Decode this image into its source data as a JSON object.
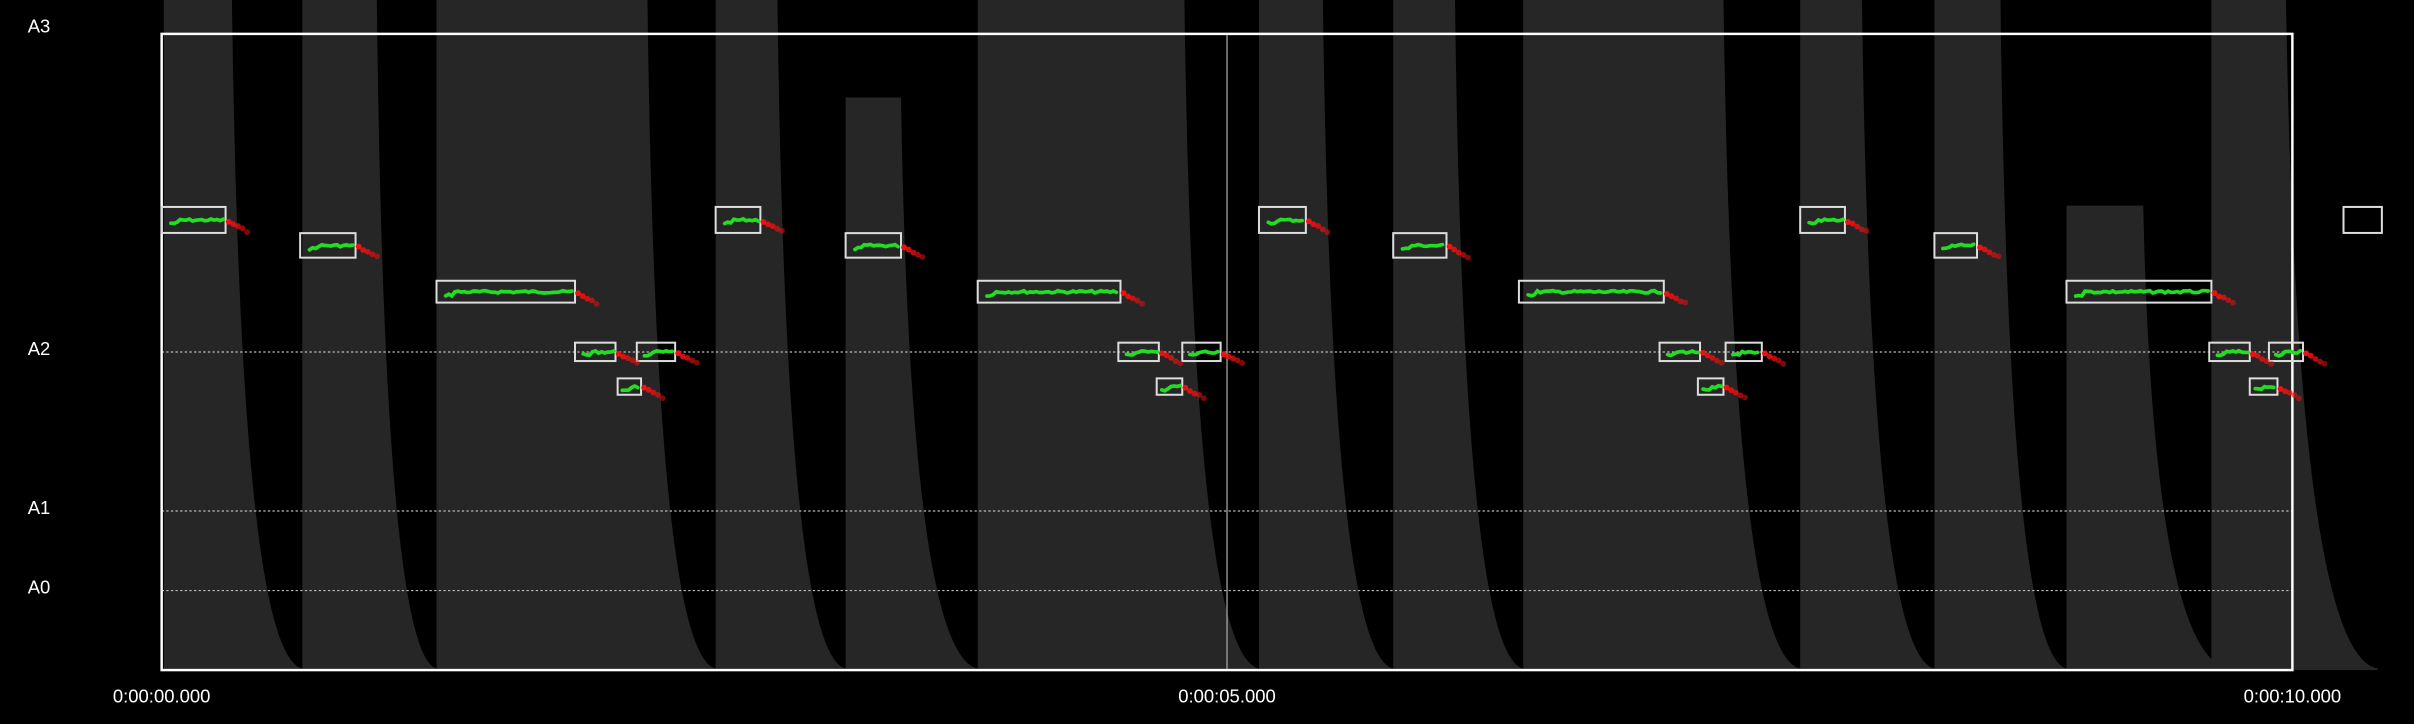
{
  "chart_data": {
    "type": "line",
    "title": "",
    "xlabel": "",
    "ylabel": "",
    "xlim": [
      0,
      10
    ],
    "ylim_hz": [
      0,
      220
    ],
    "x_ticks": [
      {
        "t": 0,
        "label": "0:00:00.000"
      },
      {
        "t": 5,
        "label": "0:00:05.000"
      },
      {
        "t": 10,
        "label": "0:00:10.000"
      }
    ],
    "y_ticks": [
      {
        "hz": 220,
        "label": "A3"
      },
      {
        "hz": 110,
        "label": "A2"
      },
      {
        "hz": 55,
        "label": "A1"
      },
      {
        "hz": 27.5,
        "label": "A0"
      }
    ],
    "grid": "dotted horizontal at A2, A1, A0; vertical at 0:00:05.000",
    "colors": {
      "background": "#000000",
      "envelope": "#262626",
      "frame": "#ffffff",
      "voiced": "#22dd22",
      "unvoiced": "#ee1111",
      "grid": "#bbbbbb"
    },
    "notes": [
      {
        "note": "D#3",
        "hz": 155.6,
        "start": 0.0,
        "end": 0.3
      },
      {
        "note": "D3",
        "hz": 146.8,
        "start": 0.65,
        "end": 0.91
      },
      {
        "note": "C3",
        "hz": 130.8,
        "start": 1.29,
        "end": 1.94
      },
      {
        "note": "A2",
        "hz": 110.0,
        "start": 1.94,
        "end": 2.13
      },
      {
        "note": "G2",
        "hz": 98.0,
        "start": 2.14,
        "end": 2.25
      },
      {
        "note": "A2",
        "hz": 110.0,
        "start": 2.23,
        "end": 2.41
      },
      {
        "note": "D#3",
        "hz": 155.6,
        "start": 2.6,
        "end": 2.81
      },
      {
        "note": "D3",
        "hz": 146.8,
        "start": 3.21,
        "end": 3.47
      },
      {
        "note": "C3",
        "hz": 130.8,
        "start": 3.83,
        "end": 4.5
      },
      {
        "note": "A2",
        "hz": 110.0,
        "start": 4.49,
        "end": 4.68
      },
      {
        "note": "G2",
        "hz": 98.0,
        "start": 4.67,
        "end": 4.79
      },
      {
        "note": "A2",
        "hz": 110.0,
        "start": 4.79,
        "end": 4.97
      },
      {
        "note": "D#3",
        "hz": 155.6,
        "start": 5.15,
        "end": 5.37
      },
      {
        "note": "D3",
        "hz": 146.8,
        "start": 5.78,
        "end": 6.03
      },
      {
        "note": "C3",
        "hz": 130.8,
        "start": 6.37,
        "end": 7.05
      },
      {
        "note": "A2",
        "hz": 110.0,
        "start": 7.03,
        "end": 7.22
      },
      {
        "note": "G2",
        "hz": 98.0,
        "start": 7.21,
        "end": 7.33
      },
      {
        "note": "A2",
        "hz": 110.0,
        "start": 7.34,
        "end": 7.51
      },
      {
        "note": "D#3",
        "hz": 155.6,
        "start": 7.69,
        "end": 7.9
      },
      {
        "note": "D3",
        "hz": 146.8,
        "start": 8.32,
        "end": 8.52
      },
      {
        "note": "C3",
        "hz": 130.8,
        "start": 8.94,
        "end": 9.62
      },
      {
        "note": "A2",
        "hz": 110.0,
        "start": 9.61,
        "end": 9.8
      },
      {
        "note": "G2",
        "hz": 98.0,
        "start": 9.8,
        "end": 9.93
      },
      {
        "note": "A2",
        "hz": 110.0,
        "start": 9.89,
        "end": 10.05
      },
      {
        "note": "D#3",
        "hz": 155.6,
        "start": 10.24,
        "end": 10.42
      }
    ],
    "envelope": [
      {
        "start": 0.01,
        "peak": 1.2,
        "decay": 0.33,
        "end": 0.66
      },
      {
        "start": 0.66,
        "peak": 1.2,
        "decay": 1.01,
        "end": 1.29
      },
      {
        "start": 1.29,
        "peak": 1.2,
        "decay": 2.28,
        "end": 2.6
      },
      {
        "start": 2.6,
        "peak": 1.2,
        "decay": 2.89,
        "end": 3.21
      },
      {
        "start": 3.21,
        "peak": 0.9,
        "decay": 3.47,
        "end": 3.83
      },
      {
        "start": 3.83,
        "peak": 1.2,
        "decay": 4.8,
        "end": 5.15
      },
      {
        "start": 5.15,
        "peak": 1.2,
        "decay": 5.45,
        "end": 5.78
      },
      {
        "start": 5.78,
        "peak": 1.2,
        "decay": 6.07,
        "end": 6.39
      },
      {
        "start": 6.39,
        "peak": 1.2,
        "decay": 7.33,
        "end": 7.69
      },
      {
        "start": 7.69,
        "peak": 1.2,
        "decay": 7.98,
        "end": 8.32
      },
      {
        "start": 8.32,
        "peak": 1.2,
        "decay": 8.63,
        "end": 8.94
      },
      {
        "start": 8.94,
        "peak": 0.73,
        "decay": 9.3,
        "end": 9.7
      },
      {
        "start": 9.62,
        "peak": 1.2,
        "decay": 9.97,
        "end": 10.4
      }
    ]
  }
}
